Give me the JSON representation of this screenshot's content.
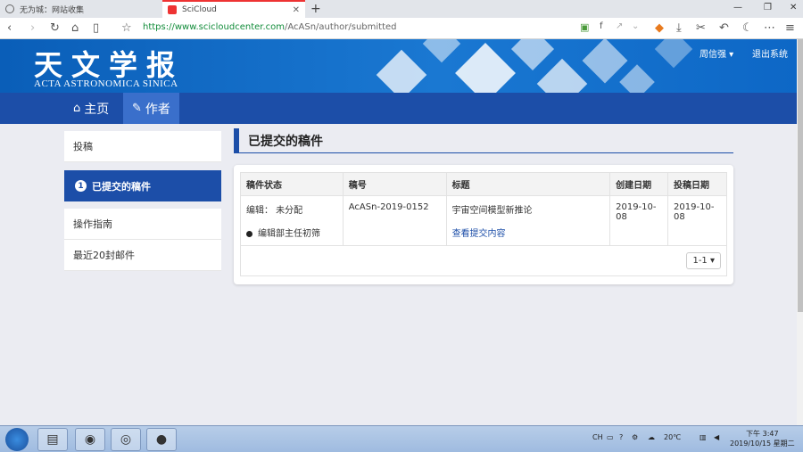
{
  "browser": {
    "tabs": [
      {
        "label": "无为城：网站收集",
        "active": false
      },
      {
        "label": "SciCloud",
        "active": true
      }
    ],
    "url_host": "https://www.scicloudcenter.com",
    "url_path": "/AcASn/author/submitted"
  },
  "site": {
    "logo_cn": "天文学报",
    "logo_en": "ACTA ASTRONOMICA SINICA",
    "user_name": "周信强",
    "logout": "退出系统"
  },
  "nav": {
    "home": "主页",
    "author": "作者"
  },
  "sidebar": {
    "items": [
      {
        "label": "投稿"
      },
      {
        "label": "已提交的稿件",
        "badge": "1",
        "active": true
      },
      {
        "label": "操作指南"
      },
      {
        "label": "最近20封邮件"
      }
    ]
  },
  "section": {
    "title": "已提交的稿件"
  },
  "table": {
    "headers": [
      "稿件状态",
      "稿号",
      "标题",
      "创建日期",
      "投稿日期"
    ],
    "rows": [
      {
        "status_editor": "编辑： 未分配",
        "status_stage": "编辑部主任初筛",
        "manuscript_no": "AcASn-2019-0152",
        "title": "宇宙空间模型新推论",
        "view_link": "查看提交内容",
        "created": "2019-10-08",
        "submitted": "2019-10-08"
      }
    ],
    "pager": "1-1"
  },
  "taskbar": {
    "lang": "CH",
    "weather": "20℃",
    "time": "下午 3:47",
    "date": "2019/10/15 星期二"
  }
}
